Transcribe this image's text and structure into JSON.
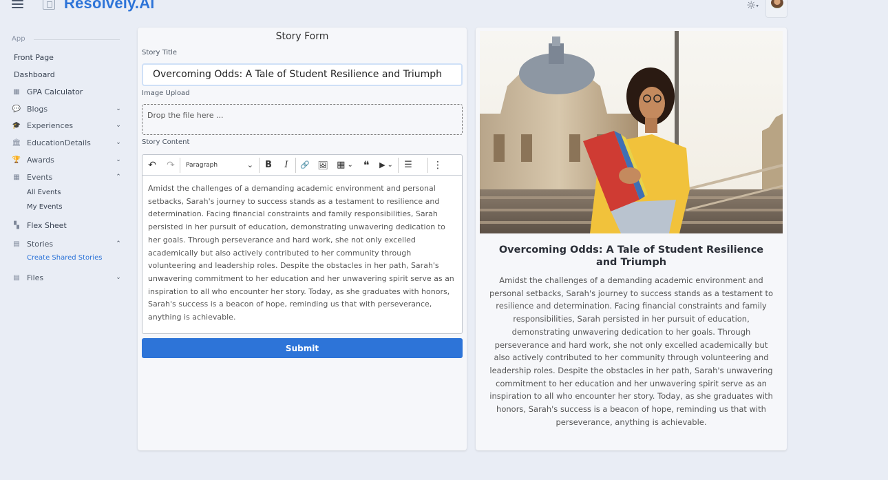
{
  "header": {
    "brand": "Resolvely.Ai",
    "menu_icon": "hamburger-icon",
    "logo_icon": "book-icon",
    "theme_icon": "sun-icon",
    "theme_caret": "▾"
  },
  "sidebar": {
    "section": "App",
    "items": [
      {
        "label": "Front Page"
      },
      {
        "label": "Dashboard"
      },
      {
        "label": "GPA Calculator",
        "icon": "calculator-icon",
        "icon_glyph": "▦"
      },
      {
        "label": "Blogs",
        "icon": "chat-icon",
        "icon_glyph": "💬"
      },
      {
        "label": "Experiences",
        "icon": "graduation-cap-icon",
        "icon_glyph": "🎓"
      },
      {
        "label": "EducationDetails",
        "icon": "building-icon",
        "icon_glyph": "🏛"
      },
      {
        "label": "Awards",
        "icon": "trophy-icon",
        "icon_glyph": "🏆"
      },
      {
        "label": "Events",
        "icon": "calendar-icon",
        "icon_glyph": "▦"
      },
      {
        "label": "Flex Sheet",
        "icon": "sheet-icon",
        "icon_glyph": "▚"
      },
      {
        "label": "Stories",
        "icon": "table-icon",
        "icon_glyph": "▤"
      },
      {
        "label": "Files",
        "icon": "table-icon",
        "icon_glyph": "▤"
      }
    ],
    "events_sub": [
      "All Events",
      "My Events"
    ],
    "stories_sub": [
      "Create Shared Stories"
    ],
    "chevron_down": "⌄",
    "chevron_up": "⌃"
  },
  "form": {
    "title": "Story Form",
    "story_title_label": "Story Title",
    "story_title_value": "Overcoming Odds: A Tale of Student Resilience and Triumph",
    "image_upload_label": "Image Upload",
    "dropzone_text": "Drop the file here ...",
    "story_content_label": "Story Content",
    "toolbar": {
      "paragraph": "Paragraph",
      "undo": "↶",
      "redo": "↷",
      "bold": "B",
      "italic": "I",
      "link": "🔗",
      "image": "🖼",
      "table": "▦",
      "quote": "❝",
      "media": "▶",
      "list": "☰",
      "more": "⋮",
      "dropdown": "⌄"
    },
    "content": "Amidst the challenges of a demanding academic environment and personal setbacks, Sarah's journey to success stands as a testament to resilience and determination. Facing financial constraints and family responsibilities, Sarah persisted in her pursuit of education, demonstrating unwavering dedication to her goals. Through perseverance and hard work, she not only excelled academically but also actively contributed to her community through volunteering and leadership roles. Despite the obstacles in her path, Sarah's unwavering commitment to her education and her unwavering spirit serve as an inspiration to all who encounter her story. Today, as she graduates with honors, Sarah's success is a beacon of hope, reminding us that with perseverance, anything is achievable.",
    "submit": "Submit"
  },
  "preview": {
    "title": "Overcoming Odds: A Tale of Student Resilience and Triumph",
    "body": "Amidst the challenges of a demanding academic environment and personal setbacks, Sarah's journey to success stands as a testament to resilience and determination. Facing financial constraints and family responsibilities, Sarah persisted in her pursuit of education, demonstrating unwavering dedication to her goals. Through perseverance and hard work, she not only excelled academically but also actively contributed to her community through volunteering and leadership roles. Despite the obstacles in her path, Sarah's unwavering commitment to her education and her unwavering spirit serve as an inspiration to all who encounter her story. Today, as she graduates with honors, Sarah's success is a beacon of hope, reminding us that with perseverance, anything is achievable."
  },
  "colors": {
    "accent": "#2d74d8",
    "background": "#e9edf5",
    "card": "#f6f7fa"
  }
}
